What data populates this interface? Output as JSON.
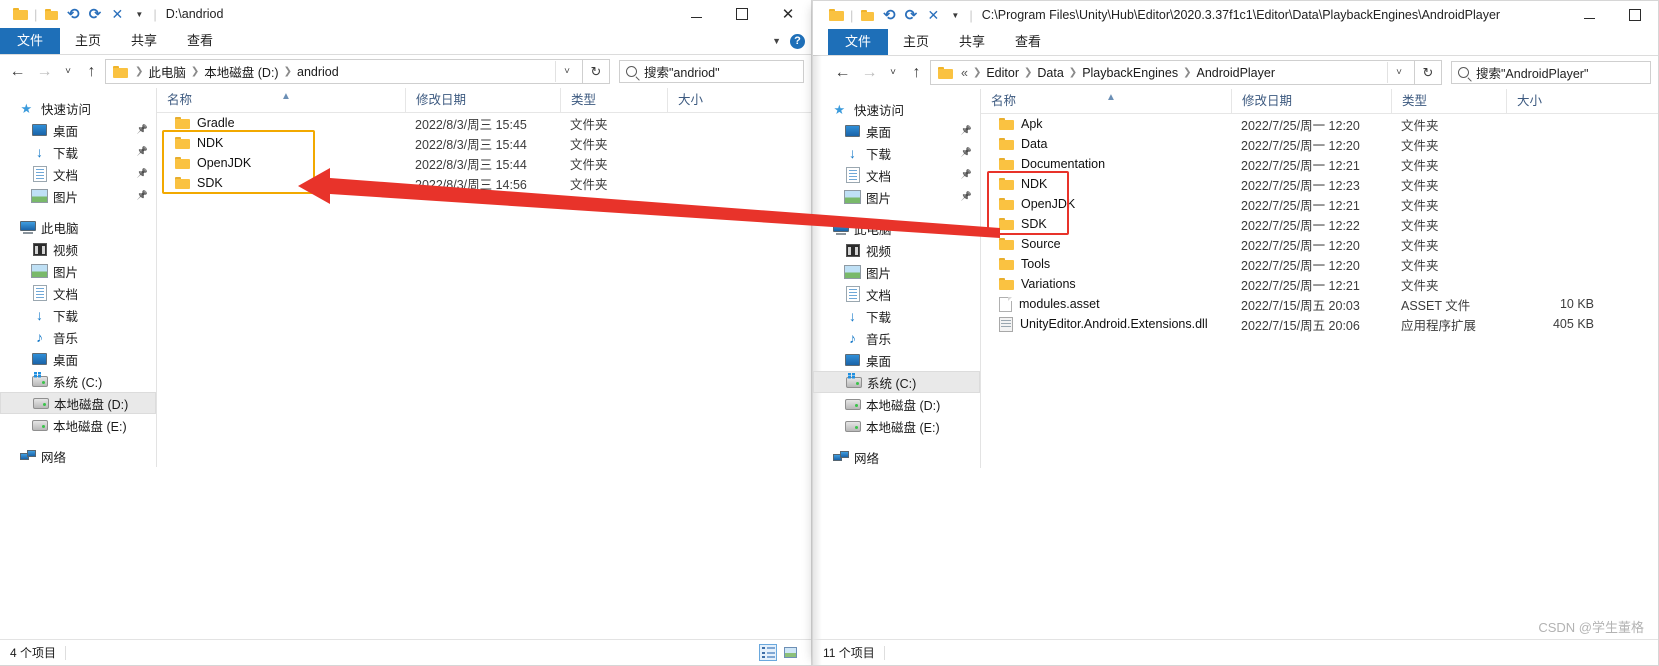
{
  "left_window": {
    "title_path": "D:\\andriod",
    "quick_access_toolbar": [
      "folder-icon",
      "folder-properties-icon",
      "undo-icon",
      "redo-icon",
      "delete-icon",
      "customize-caret-icon"
    ],
    "window_controls": {
      "minimize": "–",
      "maximize": "□",
      "close": "✕"
    },
    "ribbon_tabs": [
      {
        "label": "文件",
        "active": true
      },
      {
        "label": "主页",
        "active": false
      },
      {
        "label": "共享",
        "active": false
      },
      {
        "label": "查看",
        "active": false
      }
    ],
    "address": {
      "back": "←",
      "forward": "→",
      "recent": "˅",
      "up": "↑",
      "breadcrumb": [
        "此电脑",
        "本地磁盘 (D:)",
        "andriod"
      ],
      "refresh": "↻",
      "dropdown": "˅"
    },
    "search": {
      "placeholder": "搜索\"andriod\""
    },
    "nav_pane": [
      {
        "label": "快速访问",
        "icon": "quick-access-star-icon",
        "level": "root",
        "pinned": false,
        "selected": false
      },
      {
        "label": "桌面",
        "icon": "desktop-icon",
        "level": "child",
        "pinned": true,
        "selected": false
      },
      {
        "label": "下载",
        "icon": "downloads-icon",
        "level": "child",
        "pinned": true,
        "selected": false
      },
      {
        "label": "文档",
        "icon": "documents-icon",
        "level": "child",
        "pinned": true,
        "selected": false
      },
      {
        "label": "图片",
        "icon": "pictures-icon",
        "level": "child",
        "pinned": true,
        "selected": false
      },
      {
        "label": "此电脑",
        "icon": "this-pc-icon",
        "level": "root",
        "pinned": false,
        "selected": false
      },
      {
        "label": "视频",
        "icon": "videos-icon",
        "level": "child",
        "pinned": false,
        "selected": false
      },
      {
        "label": "图片",
        "icon": "pictures-icon",
        "level": "child",
        "pinned": false,
        "selected": false
      },
      {
        "label": "文档",
        "icon": "documents-icon",
        "level": "child",
        "pinned": false,
        "selected": false
      },
      {
        "label": "下载",
        "icon": "downloads-icon",
        "level": "child",
        "pinned": false,
        "selected": false
      },
      {
        "label": "音乐",
        "icon": "music-icon",
        "level": "child",
        "pinned": false,
        "selected": false
      },
      {
        "label": "桌面",
        "icon": "desktop-icon",
        "level": "child",
        "pinned": false,
        "selected": false
      },
      {
        "label": "系统 (C:)",
        "icon": "system-drive-icon",
        "level": "child",
        "pinned": false,
        "selected": false
      },
      {
        "label": "本地磁盘 (D:)",
        "icon": "drive-icon",
        "level": "child",
        "pinned": false,
        "selected": true
      },
      {
        "label": "本地磁盘 (E:)",
        "icon": "drive-icon",
        "level": "child",
        "pinned": false,
        "selected": false
      },
      {
        "label": "网络",
        "icon": "network-icon",
        "level": "root",
        "pinned": false,
        "selected": false
      }
    ],
    "columns": [
      "名称",
      "修改日期",
      "类型",
      "大小"
    ],
    "rows": [
      {
        "name": "Gradle",
        "icon": "folder-icon",
        "date": "2022/8/3/周三 15:45",
        "type": "文件夹",
        "size": ""
      },
      {
        "name": "NDK",
        "icon": "folder-icon",
        "date": "2022/8/3/周三 15:44",
        "type": "文件夹",
        "size": ""
      },
      {
        "name": "OpenJDK",
        "icon": "folder-icon",
        "date": "2022/8/3/周三 15:44",
        "type": "文件夹",
        "size": ""
      },
      {
        "name": "SDK",
        "icon": "folder-icon",
        "date": "2022/8/3/周三 14:56",
        "type": "文件夹",
        "size": ""
      }
    ],
    "status": {
      "item_count": "4 个项目"
    },
    "view_buttons": [
      "details-view-icon",
      "thumbnail-view-icon"
    ]
  },
  "right_window": {
    "title_path": "C:\\Program Files\\Unity\\Hub\\Editor\\2020.3.37f1c1\\Editor\\Data\\PlaybackEngines\\AndroidPlayer",
    "window_controls": {
      "minimize": "–",
      "maximize": "□"
    },
    "ribbon_tabs": [
      {
        "label": "文件",
        "active": true
      },
      {
        "label": "主页",
        "active": false
      },
      {
        "label": "共享",
        "active": false
      },
      {
        "label": "查看",
        "active": false
      }
    ],
    "address": {
      "back": "←",
      "forward": "→",
      "recent": "˅",
      "up": "↑",
      "overflow": "«",
      "breadcrumb": [
        "Editor",
        "Data",
        "PlaybackEngines",
        "AndroidPlayer"
      ],
      "refresh": "↻",
      "dropdown": "˅"
    },
    "search": {
      "placeholder": "搜索\"AndroidPlayer\""
    },
    "nav_pane": [
      {
        "label": "快速访问",
        "icon": "quick-access-star-icon",
        "level": "root",
        "pinned": false,
        "selected": false
      },
      {
        "label": "桌面",
        "icon": "desktop-icon",
        "level": "child",
        "pinned": true,
        "selected": false
      },
      {
        "label": "下载",
        "icon": "downloads-icon",
        "level": "child",
        "pinned": true,
        "selected": false
      },
      {
        "label": "文档",
        "icon": "documents-icon",
        "level": "child",
        "pinned": true,
        "selected": false
      },
      {
        "label": "图片",
        "icon": "pictures-icon",
        "level": "child",
        "pinned": true,
        "selected": false
      },
      {
        "label": "此电脑",
        "icon": "this-pc-icon",
        "level": "root",
        "pinned": false,
        "selected": false
      },
      {
        "label": "视频",
        "icon": "videos-icon",
        "level": "child",
        "pinned": false,
        "selected": false
      },
      {
        "label": "图片",
        "icon": "pictures-icon",
        "level": "child",
        "pinned": false,
        "selected": false
      },
      {
        "label": "文档",
        "icon": "documents-icon",
        "level": "child",
        "pinned": false,
        "selected": false
      },
      {
        "label": "下载",
        "icon": "downloads-icon",
        "level": "child",
        "pinned": false,
        "selected": false
      },
      {
        "label": "音乐",
        "icon": "music-icon",
        "level": "child",
        "pinned": false,
        "selected": false
      },
      {
        "label": "桌面",
        "icon": "desktop-icon",
        "level": "child",
        "pinned": false,
        "selected": false
      },
      {
        "label": "系统 (C:)",
        "icon": "system-drive-icon",
        "level": "child",
        "pinned": false,
        "selected": true
      },
      {
        "label": "本地磁盘 (D:)",
        "icon": "drive-icon",
        "level": "child",
        "pinned": false,
        "selected": false
      },
      {
        "label": "本地磁盘 (E:)",
        "icon": "drive-icon",
        "level": "child",
        "pinned": false,
        "selected": false
      },
      {
        "label": "网络",
        "icon": "network-icon",
        "level": "root",
        "pinned": false,
        "selected": false
      }
    ],
    "columns": [
      "名称",
      "修改日期",
      "类型",
      "大小"
    ],
    "rows": [
      {
        "name": "Apk",
        "icon": "folder-icon",
        "date": "2022/7/25/周一 12:20",
        "type": "文件夹",
        "size": ""
      },
      {
        "name": "Data",
        "icon": "folder-icon",
        "date": "2022/7/25/周一 12:20",
        "type": "文件夹",
        "size": ""
      },
      {
        "name": "Documentation",
        "icon": "folder-icon",
        "date": "2022/7/25/周一 12:21",
        "type": "文件夹",
        "size": ""
      },
      {
        "name": "NDK",
        "icon": "folder-icon",
        "date": "2022/7/25/周一 12:23",
        "type": "文件夹",
        "size": ""
      },
      {
        "name": "OpenJDK",
        "icon": "folder-icon",
        "date": "2022/7/25/周一 12:21",
        "type": "文件夹",
        "size": ""
      },
      {
        "name": "SDK",
        "icon": "folder-icon",
        "date": "2022/7/25/周一 12:22",
        "type": "文件夹",
        "size": ""
      },
      {
        "name": "Source",
        "icon": "folder-icon",
        "date": "2022/7/25/周一 12:20",
        "type": "文件夹",
        "size": ""
      },
      {
        "name": "Tools",
        "icon": "folder-icon",
        "date": "2022/7/25/周一 12:20",
        "type": "文件夹",
        "size": ""
      },
      {
        "name": "Variations",
        "icon": "folder-icon",
        "date": "2022/7/25/周一 12:21",
        "type": "文件夹",
        "size": ""
      },
      {
        "name": "modules.asset",
        "icon": "file-icon",
        "date": "2022/7/15/周五 20:03",
        "type": "ASSET 文件",
        "size": "10 KB"
      },
      {
        "name": "UnityEditor.Android.Extensions.dll",
        "icon": "dll-icon",
        "date": "2022/7/15/周五 20:06",
        "type": "应用程序扩展",
        "size": "405 KB"
      }
    ],
    "status": {
      "item_count": "11 个项目"
    }
  },
  "annotations": {
    "left_highlight": {
      "color": "#f2a900",
      "targets": [
        "NDK",
        "OpenJDK",
        "SDK"
      ]
    },
    "right_highlight": {
      "color": "#e8332a",
      "targets": [
        "NDK",
        "OpenJDK",
        "SDK"
      ]
    },
    "arrow": {
      "color": "#e8332a",
      "direction": "right-to-left",
      "from": "right_window_highlight",
      "to": "left_window_highlight"
    }
  },
  "watermark": {
    "text": "CSDN @学生董格"
  }
}
